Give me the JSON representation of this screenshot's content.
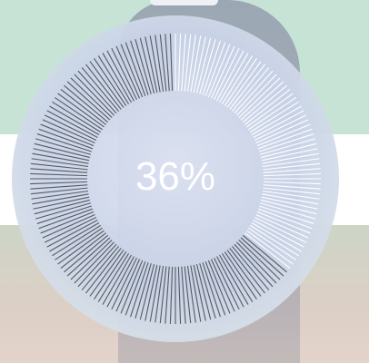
{
  "progress": {
    "label": "36%",
    "value": 36,
    "fill_color": "#ffffff",
    "remaining_color": "#555a60"
  },
  "background": {
    "top_color": "#c6e3d6",
    "mid_color": "#ffffff"
  }
}
